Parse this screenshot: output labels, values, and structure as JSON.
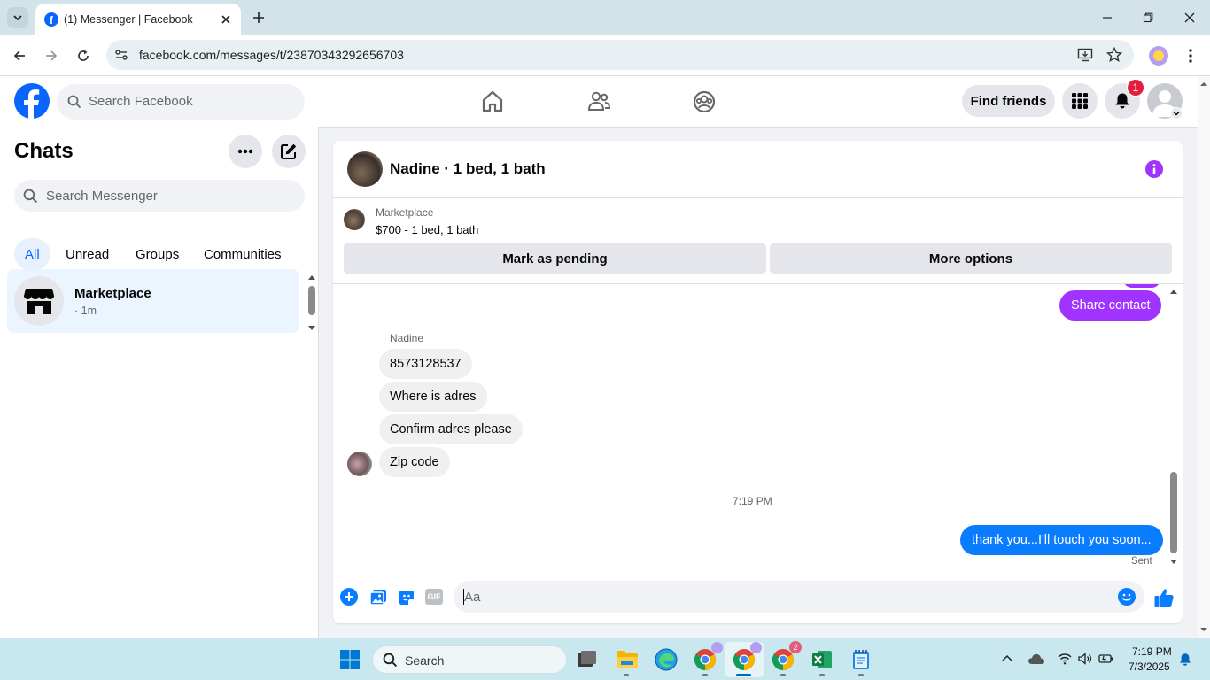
{
  "browser": {
    "tab_title": "(1) Messenger | Facebook",
    "url": "facebook.com/messages/t/23870343292656703"
  },
  "header": {
    "search_placeholder": "Search Facebook",
    "find_friends_label": "Find friends",
    "notification_count": "1"
  },
  "sidebar": {
    "title": "Chats",
    "search_placeholder": "Search Messenger",
    "filters": [
      "All",
      "Unread",
      "Groups",
      "Communities"
    ],
    "active_filter": "All",
    "chats": [
      {
        "name": "Marketplace",
        "preview": "· 1m"
      }
    ]
  },
  "conversation": {
    "title": "Nadine · 1 bed, 1 bath",
    "listing": {
      "label": "Marketplace",
      "title": "$700 - 1 bed, 1 bath"
    },
    "mark_pending_label": "Mark as pending",
    "more_options_label": "More options",
    "share_contact_label": "Share contact",
    "sender_name": "Nadine",
    "incoming": [
      "8573128537",
      "Where is adres",
      "Confirm adres please",
      "Zip code"
    ],
    "timestamp": "7:19 PM",
    "outgoing": "thank you...I'll touch you soon...",
    "sent_status": "Sent",
    "composer_placeholder": "Aa"
  },
  "taskbar": {
    "search_label": "Search",
    "time": "7:19 PM",
    "date": "7/3/2025",
    "chrome_badge": "2"
  },
  "colors": {
    "fb_blue": "#0866ff",
    "purple": "#a033ff",
    "messenger_blue": "#0a7cff"
  }
}
